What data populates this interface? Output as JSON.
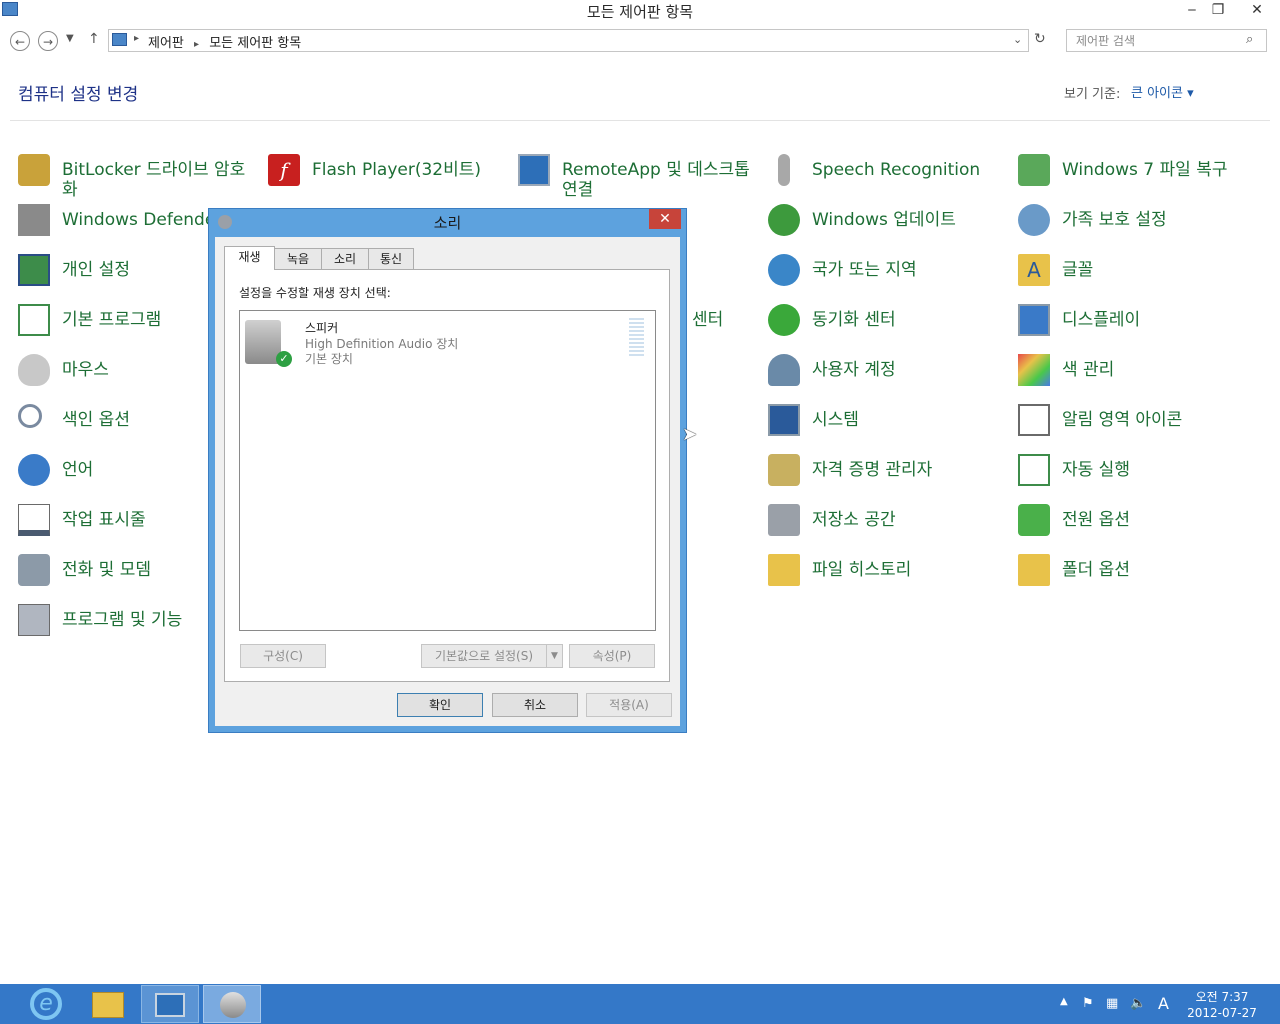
{
  "window": {
    "title": "모든 제어판 항목",
    "minimize": "‒",
    "restore": "❐",
    "close": "✕"
  },
  "address": {
    "breadcrumb": [
      "제어판",
      "모든 제어판 항목"
    ],
    "search_placeholder": "제어판 검색"
  },
  "header": {
    "title": "컴퓨터 설정 변경",
    "view_by_label": "보기 기준:",
    "view_by_value": "큰 아이콘 ▾"
  },
  "items": [
    {
      "label": "BitLocker 드라이브 암호",
      "label2": "화",
      "icon": "bitlocker-icon"
    },
    {
      "label": "Windows Defender",
      "icon": "defender-icon"
    },
    {
      "label": "개인 설정",
      "icon": "personalization-icon"
    },
    {
      "label": "기본 프로그램",
      "icon": "default-programs-icon"
    },
    {
      "label": "마우스",
      "icon": "mouse-icon"
    },
    {
      "label": "색인 옵션",
      "icon": "indexing-icon"
    },
    {
      "label": "언어",
      "icon": "language-icon"
    },
    {
      "label": "작업 표시줄",
      "icon": "taskbar-icon"
    },
    {
      "label": "전화 및 모뎀",
      "icon": "phone-icon"
    },
    {
      "label": "프로그램 및 기능",
      "icon": "programs-icon"
    },
    {
      "label": "Flash Player(32비트)",
      "icon": "flash-icon"
    },
    {
      "label": "RemoteApp 및 데스크톱",
      "label2": "연결",
      "icon": "remoteapp-icon"
    },
    {
      "label": "센터",
      "icon": "center-icon"
    },
    {
      "label": "Speech Recognition",
      "icon": "microphone-icon"
    },
    {
      "label": "Windows 업데이트",
      "icon": "update-icon"
    },
    {
      "label": "국가 또는 지역",
      "icon": "region-icon"
    },
    {
      "label": "동기화 센터",
      "icon": "sync-icon"
    },
    {
      "label": "사용자 계정",
      "icon": "user-accounts-icon"
    },
    {
      "label": "시스템",
      "icon": "system-icon"
    },
    {
      "label": "자격 증명 관리자",
      "icon": "credential-icon"
    },
    {
      "label": "저장소 공간",
      "icon": "storage-icon"
    },
    {
      "label": "파일 히스토리",
      "icon": "file-history-icon"
    },
    {
      "label": "Windows 7 파일 복구",
      "icon": "recovery-icon"
    },
    {
      "label": "가족 보호 설정",
      "icon": "family-icon"
    },
    {
      "label": "글꼴",
      "icon": "fonts-icon"
    },
    {
      "label": "디스플레이",
      "icon": "display-icon"
    },
    {
      "label": "색 관리",
      "icon": "color-icon"
    },
    {
      "label": "알림 영역 아이콘",
      "icon": "notification-icon"
    },
    {
      "label": "자동 실행",
      "icon": "autoplay-icon"
    },
    {
      "label": "전원 옵션",
      "icon": "power-icon"
    },
    {
      "label": "폴더 옵션",
      "icon": "folder-options-icon"
    }
  ],
  "dialog": {
    "title": "소리",
    "close": "✕",
    "tabs": [
      "재생",
      "녹음",
      "소리",
      "통신"
    ],
    "instruction": "설정을 수정할 재생 장치 선택:",
    "device": {
      "name": "스피커",
      "description": "High Definition Audio 장치",
      "status": "기본 장치"
    },
    "buttons": {
      "configure": "구성(C)",
      "set_default": "기본값으로 설정(S)",
      "properties": "속성(P)",
      "ok": "확인",
      "cancel": "취소",
      "apply": "적용(A)"
    }
  },
  "taskbar": {
    "clock_time": "오전 7:37",
    "clock_date": "2012-07-27",
    "ime": "A",
    "colors": {
      "bar": "#3478c8",
      "accent": "#1d6e35"
    }
  }
}
